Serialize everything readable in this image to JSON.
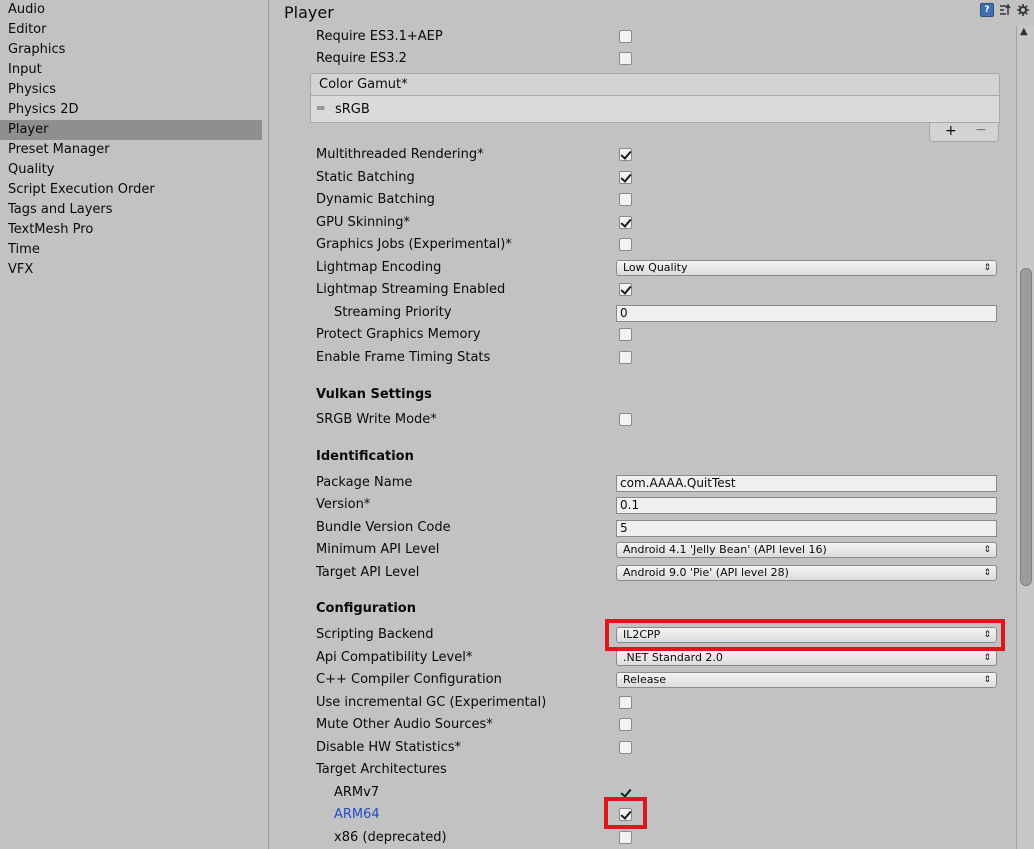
{
  "sidebar": {
    "items": [
      {
        "label": "Audio"
      },
      {
        "label": "Editor"
      },
      {
        "label": "Graphics"
      },
      {
        "label": "Input"
      },
      {
        "label": "Physics"
      },
      {
        "label": "Physics 2D"
      },
      {
        "label": "Player",
        "selected": true
      },
      {
        "label": "Preset Manager"
      },
      {
        "label": "Quality"
      },
      {
        "label": "Script Execution Order"
      },
      {
        "label": "Tags and Layers"
      },
      {
        "label": "TextMesh Pro"
      },
      {
        "label": "Time"
      },
      {
        "label": "VFX"
      }
    ]
  },
  "header": {
    "title": "Player",
    "icons": [
      "help-icon",
      "preset-icon",
      "gear-icon"
    ]
  },
  "settings": {
    "require_es31_aep": {
      "label": "Require ES3.1+AEP",
      "checked": false
    },
    "require_es32": {
      "label": "Require ES3.2",
      "checked": false
    },
    "color_gamut": {
      "label": "Color Gamut*",
      "items": [
        "sRGB"
      ],
      "add": "+",
      "remove": "−"
    },
    "multithreaded": {
      "label": "Multithreaded Rendering*",
      "checked": true
    },
    "static_batching": {
      "label": "Static Batching",
      "checked": true
    },
    "dynamic_batching": {
      "label": "Dynamic Batching",
      "checked": false
    },
    "gpu_skinning": {
      "label": "GPU Skinning*",
      "checked": true
    },
    "graphics_jobs": {
      "label": "Graphics Jobs (Experimental)*",
      "checked": false
    },
    "lightmap_encoding": {
      "label": "Lightmap Encoding",
      "value": "Low Quality"
    },
    "lightmap_streaming": {
      "label": "Lightmap Streaming Enabled",
      "checked": true
    },
    "streaming_priority": {
      "label": "Streaming Priority",
      "value": "0"
    },
    "protect_memory": {
      "label": "Protect Graphics Memory",
      "checked": false
    },
    "frame_timing": {
      "label": "Enable Frame Timing Stats",
      "checked": false
    },
    "vulkan_title": "Vulkan Settings",
    "srgb_write": {
      "label": "SRGB Write Mode*",
      "checked": false
    },
    "identification_title": "Identification",
    "package_name": {
      "label": "Package Name",
      "value": "com.AAAA.QuitTest"
    },
    "version": {
      "label": "Version*",
      "value": "0.1"
    },
    "bundle_code": {
      "label": "Bundle Version Code",
      "value": "5"
    },
    "min_api": {
      "label": "Minimum API Level",
      "value": "Android 4.1 'Jelly Bean' (API level 16)"
    },
    "target_api": {
      "label": "Target API Level",
      "value": "Android 9.0 'Pie' (API level 28)"
    },
    "configuration_title": "Configuration",
    "scripting_backend": {
      "label": "Scripting Backend",
      "value": "IL2CPP"
    },
    "api_compat": {
      "label": "Api Compatibility Level*",
      "value": ".NET Standard 2.0"
    },
    "cpp_config": {
      "label": "C++ Compiler Configuration",
      "value": "Release"
    },
    "incremental_gc": {
      "label": "Use incremental GC (Experimental)",
      "checked": false
    },
    "mute_audio": {
      "label": "Mute Other Audio Sources*",
      "checked": false
    },
    "disable_hw_stats": {
      "label": "Disable HW Statistics*",
      "checked": false
    },
    "target_arch": {
      "label": "Target Architectures"
    },
    "armv7": {
      "label": "ARMv7",
      "checked": true
    },
    "arm64": {
      "label": "ARM64",
      "checked": true
    },
    "x86": {
      "label": "x86 (deprecated)",
      "checked": false
    }
  },
  "colors": {
    "highlight": "#e0151f",
    "selected_sidebar": "#8f8f8f",
    "link_blue": "#1e4ec8"
  }
}
